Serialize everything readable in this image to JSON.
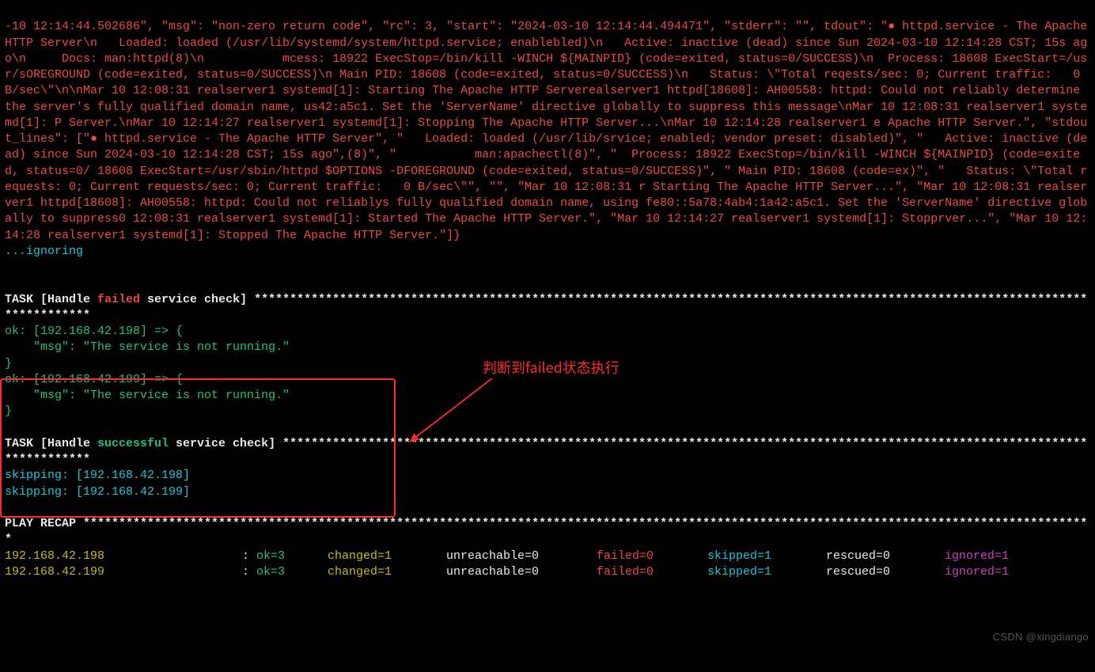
{
  "log_block": "-10 12:14:44.502686\", \"msg\": \"non-zero return code\", \"rc\": 3, \"start\": \"2024-03-10 12:14:44.494471\", \"stderr\": \"\", tdout\": \"● httpd.service - The Apache HTTP Server\\n   Loaded: loaded (/usr/lib/systemd/system/httpd.service; enablebled)\\n   Active: inactive (dead) since Sun 2024-03-10 12:14:28 CST; 15s ago\\n     Docs: man:httpd(8)\\n           mcess: 18922 ExecStop=/bin/kill -WINCH ${MAINPID} (code=exited, status=0/SUCCESS)\\n  Process: 18608 ExecStart=/usr/sOREGROUND (code=exited, status=0/SUCCESS)\\n Main PID: 18608 (code=exited, status=0/SUCCESS)\\n   Status: \\\"Total reqests/sec: 0; Current traffic:   0 B/sec\\\"\\n\\nMar 10 12:08:31 realserver1 systemd[1]: Starting The Apache HTTP Serverealserver1 httpd[18608]: AH00558: httpd: Could not reliably determine the server's fully qualified domain name, us42:a5c1. Set the 'ServerName' directive globally to suppress this message\\nMar 10 12:08:31 realserver1 systemd[1]: P Server.\\nMar 10 12:14:27 realserver1 systemd[1]: Stopping The Apache HTTP Server...\\nMar 10 12:14:28 realserver1 e Apache HTTP Server.\", \"stdout_lines\": [\"● httpd.service - The Apache HTTP Server\", \"   Loaded: loaded (/usr/lib/srvice; enabled; vendor preset: disabled)\", \"   Active: inactive (dead) since Sun 2024-03-10 12:14:28 CST; 15s ago\",(8)\", \"           man:apachectl(8)\", \"  Process: 18922 ExecStop=/bin/kill -WINCH ${MAINPID} (code=exited, status=0/ 18608 ExecStart=/usr/sbin/httpd $OPTIONS -DFOREGROUND (code=exited, status=0/SUCCESS)\", \" Main PID: 18608 (code=ex)\", \"   Status: \\\"Total requests: 0; Current requests/sec: 0; Current traffic:   0 B/sec\\\"\", \"\", \"Mar 10 12:08:31 r Starting The Apache HTTP Server...\", \"Mar 10 12:08:31 realserver1 httpd[18608]: AH00558: httpd: Could not reliablys fully qualified domain name, using fe80::5a78:4ab4:1a42:a5c1. Set the 'ServerName' directive globally to suppress0 12:08:31 realserver1 systemd[1]: Started The Apache HTTP Server.\", \"Mar 10 12:14:27 realserver1 systemd[1]: Stopprver...\", \"Mar 10 12:14:28 realserver1 systemd[1]: Stopped The Apache HTTP Server.\"]}",
  "ignoring": "...ignoring",
  "annotation": "判断到failed状态执行",
  "task_failed": {
    "prefix": "TASK [Handle ",
    "failed_word": "failed",
    "suffix": " service check] ",
    "stars": "*********************************************************************************************************************************",
    "body_198": "ok: [192.168.42.198] => {\n    \"msg\": \"The service is not running.\"\n}",
    "body_199": "ok: [192.168.42.199] => {\n    \"msg\": \"The service is not running.\"\n}"
  },
  "task_success": {
    "prefix": "TASK [Handle ",
    "success_word": "successful",
    "suffix": " service check] ",
    "stars": "*****************************************************************************************************************************",
    "skip1_a": "skipping: ",
    "skip1_b": "[192.168.42.198]",
    "skip2_a": "skipping: ",
    "skip2_b": "[192.168.42.199]"
  },
  "recap": {
    "header": "PLAY RECAP ",
    "stars": "**********************************************************************************************************************************************",
    "rows": [
      {
        "host": "192.168.42.198",
        "ok": "ok=3",
        "changed": "changed=1",
        "unreachable": "unreachable=0",
        "failed": "failed=0",
        "skipped": "skipped=1",
        "rescued": "rescued=0",
        "ignored": "ignored=1"
      },
      {
        "host": "192.168.42.199",
        "ok": "ok=3",
        "changed": "changed=1",
        "unreachable": "unreachable=0",
        "failed": "failed=0",
        "skipped": "skipped=1",
        "rescued": "rescued=0",
        "ignored": "ignored=1"
      }
    ],
    "colon": ": "
  },
  "watermark": "CSDN @xingdiango"
}
